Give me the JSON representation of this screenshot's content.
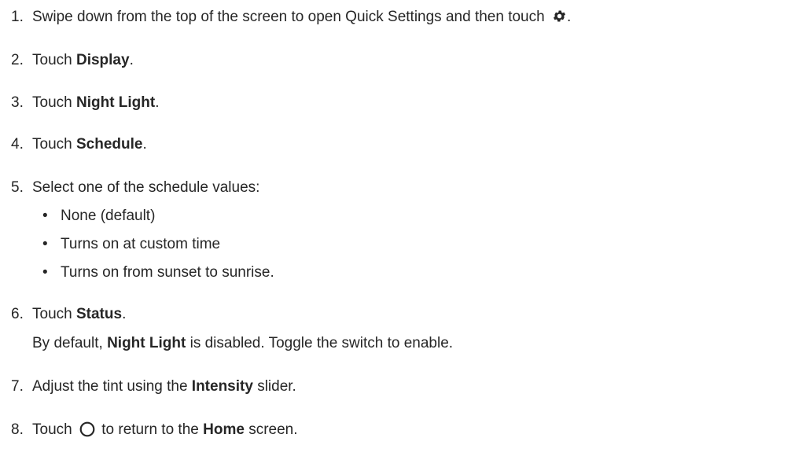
{
  "steps": [
    {
      "number": "1.",
      "text": "Swipe down from the top of the screen to open Quick Settings and then touch ",
      "icon": "gear-icon",
      "after": "."
    },
    {
      "number": "2.",
      "pre": "Touch ",
      "bold": "Display",
      "post": "."
    },
    {
      "number": "3.",
      "pre": "Touch ",
      "bold": "Night Light",
      "post": "."
    },
    {
      "number": "4.",
      "pre": "Touch ",
      "bold": "Schedule",
      "post": "."
    },
    {
      "number": "5.",
      "text": "Select one of the schedule values:",
      "bullets": [
        "None (default)",
        "Turns on at custom time",
        "Turns on from sunset to sunrise."
      ]
    },
    {
      "number": "6.",
      "pre": "Touch ",
      "bold": "Status",
      "post": ".",
      "note": {
        "pre": "By default, ",
        "bold": "Night Light",
        "post": " is disabled. Toggle the switch to enable."
      }
    },
    {
      "number": "7.",
      "pre": "Adjust the tint using the ",
      "bold": "Intensity",
      "post": " slider."
    },
    {
      "number": "8.",
      "pre": "Touch ",
      "icon": "home-circle-icon",
      "mid": " to return to the ",
      "bold": "Home",
      "post": " screen."
    }
  ]
}
